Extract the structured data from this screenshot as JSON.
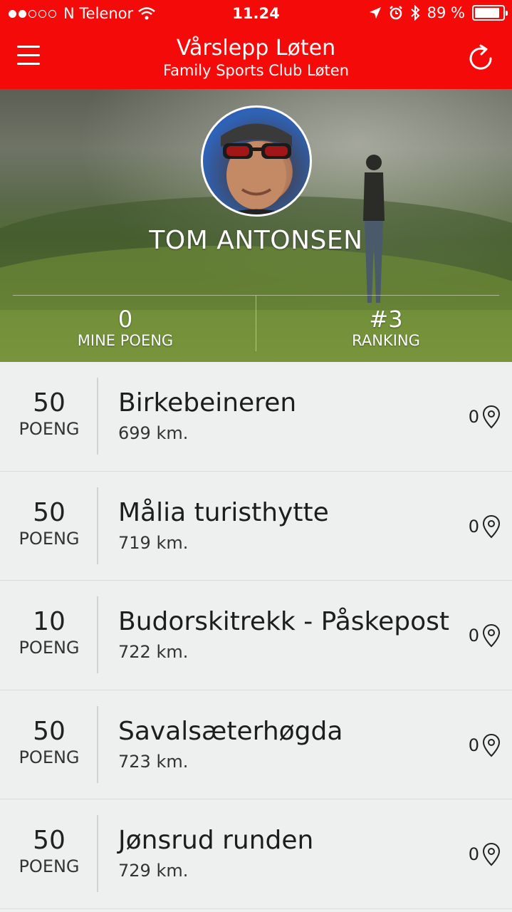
{
  "status_bar": {
    "carrier": "N Telenor",
    "time": "11.24",
    "battery": "89 %",
    "battery_level": 0.89,
    "signal_bars_filled": 2,
    "signal_bars_total": 5
  },
  "nav": {
    "title": "Vårslepp Løten",
    "subtitle": "Family Sports Club Løten"
  },
  "profile": {
    "name": "TOM ANTONSEN",
    "points_value": "0",
    "points_label": "MINE POENG",
    "ranking_value": "#3",
    "ranking_label": "RANKING"
  },
  "checkpoints": [
    {
      "points": "50",
      "unit": "POENG",
      "name": "Birkebeineren",
      "distance": "699 km.",
      "count": "0"
    },
    {
      "points": "50",
      "unit": "POENG",
      "name": "Målia turisthytte",
      "distance": "719 km.",
      "count": "0"
    },
    {
      "points": "10",
      "unit": "POENG",
      "name": "Budorskitrekk - Påskepost",
      "distance": "722 km.",
      "count": "0"
    },
    {
      "points": "50",
      "unit": "POENG",
      "name": "Savalsæterhøgda",
      "distance": "723 km.",
      "count": "0"
    },
    {
      "points": "50",
      "unit": "POENG",
      "name": "Jønsrud runden",
      "distance": "729 km.",
      "count": "0"
    }
  ],
  "colors": {
    "brand_red": "#f50a0a",
    "list_background": "#eef0ef"
  },
  "icons": [
    "menu-icon",
    "refresh-icon",
    "wifi-icon",
    "location-arrow-icon",
    "alarm-icon",
    "bluetooth-icon",
    "battery-icon",
    "map-pin-icon"
  ]
}
